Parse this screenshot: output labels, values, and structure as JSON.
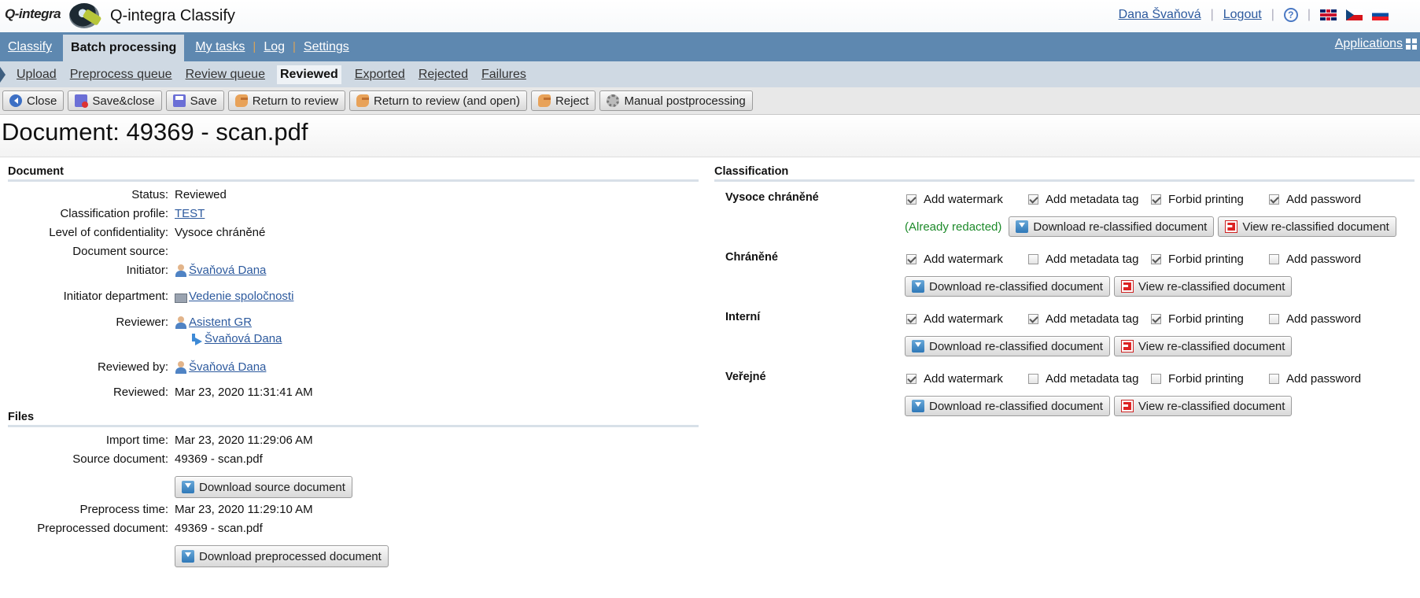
{
  "app": {
    "logo_text": "Q-integra",
    "title": "Q-integra Classify"
  },
  "user": {
    "name": "Dana Švaňová",
    "logout": "Logout",
    "help": "?"
  },
  "main_nav": [
    {
      "label": "Classify",
      "active": false
    },
    {
      "label": "Batch processing",
      "active": true
    },
    {
      "label": "My tasks",
      "active": false
    },
    {
      "label": "Log",
      "active": false
    },
    {
      "label": "Settings",
      "active": false
    }
  ],
  "applications_label": "Applications",
  "sub_nav": [
    {
      "label": "Upload",
      "active": false
    },
    {
      "label": "Preprocess queue",
      "active": false
    },
    {
      "label": "Review queue",
      "active": false
    },
    {
      "label": "Reviewed",
      "active": true
    },
    {
      "label": "Exported",
      "active": false
    },
    {
      "label": "Rejected",
      "active": false
    },
    {
      "label": "Failures",
      "active": false
    }
  ],
  "toolbar": {
    "close": "Close",
    "save_close": "Save&close",
    "save": "Save",
    "return_review": "Return to review",
    "return_review_open": "Return to review (and open)",
    "reject": "Reject",
    "manual_post": "Manual postprocessing"
  },
  "document_title": "Document: 49369 - scan.pdf",
  "document": {
    "heading": "Document",
    "status_label": "Status:",
    "status": "Reviewed",
    "profile_label": "Classification profile:",
    "profile": "TEST",
    "confidentiality_label": "Level of confidentiality:",
    "confidentiality": "Vysoce chráněné",
    "source_label": "Document source:",
    "source": "",
    "initiator_label": "Initiator:",
    "initiator": "Švaňová Dana",
    "dept_label": "Initiator department:",
    "dept": "Vedenie spoločnosti",
    "reviewer_label": "Reviewer:",
    "reviewer": "Asistent GR",
    "reviewer_forward": "Švaňová Dana",
    "reviewed_by_label": "Reviewed by:",
    "reviewed_by": "Švaňová Dana",
    "reviewed_label": "Reviewed:",
    "reviewed": "Mar 23, 2020 11:31:41 AM"
  },
  "files": {
    "heading": "Files",
    "import_label": "Import time:",
    "import_time": "Mar 23, 2020 11:29:06 AM",
    "source_label": "Source document:",
    "source_doc": "49369 - scan.pdf",
    "download_source": "Download source document",
    "preprocess_label": "Preprocess time:",
    "preprocess_time": "Mar 23, 2020 11:29:10 AM",
    "preprocessed_label": "Preprocessed document:",
    "preprocessed_doc": "49369 - scan.pdf",
    "download_preprocessed": "Download preprocessed document"
  },
  "classification": {
    "heading": "Classification",
    "option_labels": {
      "watermark": "Add watermark",
      "metadata": "Add metadata tag",
      "printing": "Forbid printing",
      "password": "Add password"
    },
    "download_label": "Download re-classified document",
    "view_label": "View re-classified document",
    "already_redacted": "(Already redacted)",
    "levels": [
      {
        "name": "Vysoce chráněné",
        "watermark": true,
        "metadata": true,
        "printing": true,
        "password": true
      },
      {
        "name": "Chráněné",
        "watermark": true,
        "metadata": false,
        "printing": true,
        "password": false
      },
      {
        "name": "Interní",
        "watermark": true,
        "metadata": true,
        "printing": true,
        "password": false
      },
      {
        "name": "Veřejné",
        "watermark": true,
        "metadata": false,
        "printing": false,
        "password": false
      }
    ]
  }
}
